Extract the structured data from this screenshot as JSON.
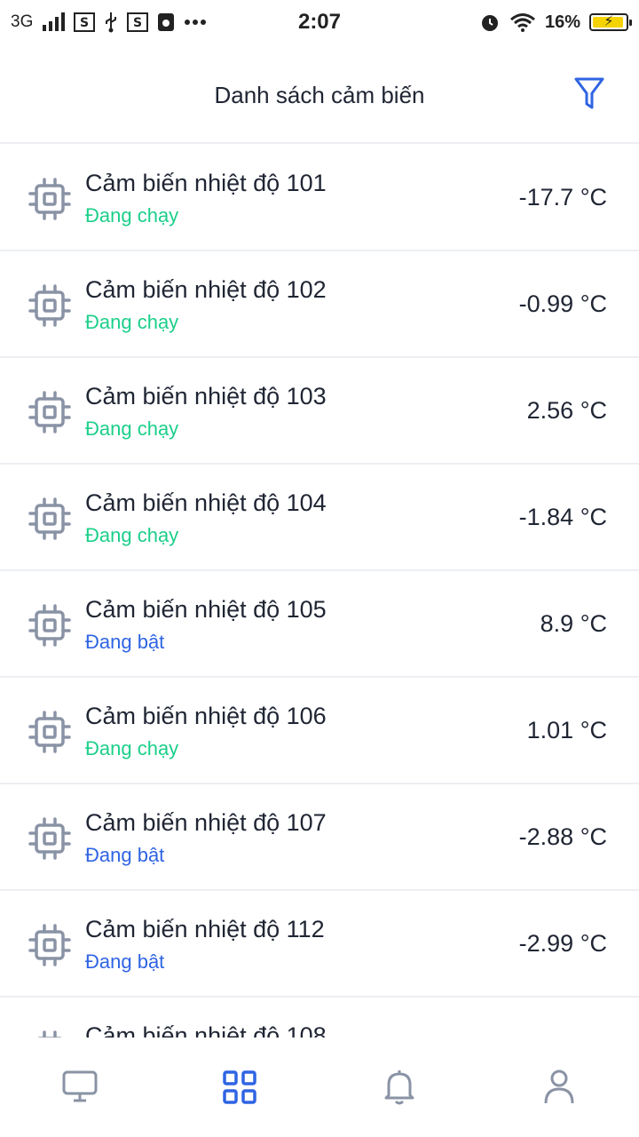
{
  "status_bar": {
    "network": "3G",
    "time": "2:07",
    "battery": "16%",
    "icons_left": [
      "signal-icon",
      "sim-s-icon",
      "usb-icon",
      "sim-s-icon",
      "app-icon",
      "more-dots-icon"
    ],
    "icons_right": [
      "alarm-icon",
      "wifi-icon",
      "battery-charging-icon"
    ]
  },
  "header": {
    "title": "Danh sách cảm biến",
    "filter_icon": "filter-icon"
  },
  "colors": {
    "running": "#1ccf8a",
    "on": "#2f64e3",
    "icon_gray": "#8a93a5",
    "accent": "#2f64e3"
  },
  "sensors": [
    {
      "name": "Cảm biến nhiệt độ 101",
      "status": "Đang chạy",
      "status_type": "running",
      "value": "-17.7 °C"
    },
    {
      "name": "Cảm biến nhiệt độ 102",
      "status": "Đang chạy",
      "status_type": "running",
      "value": "-0.99 °C"
    },
    {
      "name": "Cảm biến nhiệt độ 103",
      "status": "Đang chạy",
      "status_type": "running",
      "value": "2.56 °C"
    },
    {
      "name": "Cảm biến nhiệt độ 104",
      "status": "Đang chạy",
      "status_type": "running",
      "value": "-1.84 °C"
    },
    {
      "name": "Cảm biến nhiệt độ 105",
      "status": "Đang bật",
      "status_type": "on",
      "value": "8.9 °C"
    },
    {
      "name": "Cảm biến nhiệt độ 106",
      "status": "Đang chạy",
      "status_type": "running",
      "value": "1.01 °C"
    },
    {
      "name": "Cảm biến nhiệt độ 107",
      "status": "Đang bật",
      "status_type": "on",
      "value": "-2.88 °C"
    },
    {
      "name": "Cảm biến nhiệt độ 112",
      "status": "Đang bật",
      "status_type": "on",
      "value": "-2.99 °C"
    },
    {
      "name": "Cảm biến nhiệt độ 108",
      "status": "",
      "status_type": "running",
      "value": ""
    }
  ],
  "bottom_nav": [
    {
      "icon": "monitor-icon",
      "active": false
    },
    {
      "icon": "grid-icon",
      "active": true
    },
    {
      "icon": "bell-icon",
      "active": false
    },
    {
      "icon": "user-icon",
      "active": false
    }
  ]
}
